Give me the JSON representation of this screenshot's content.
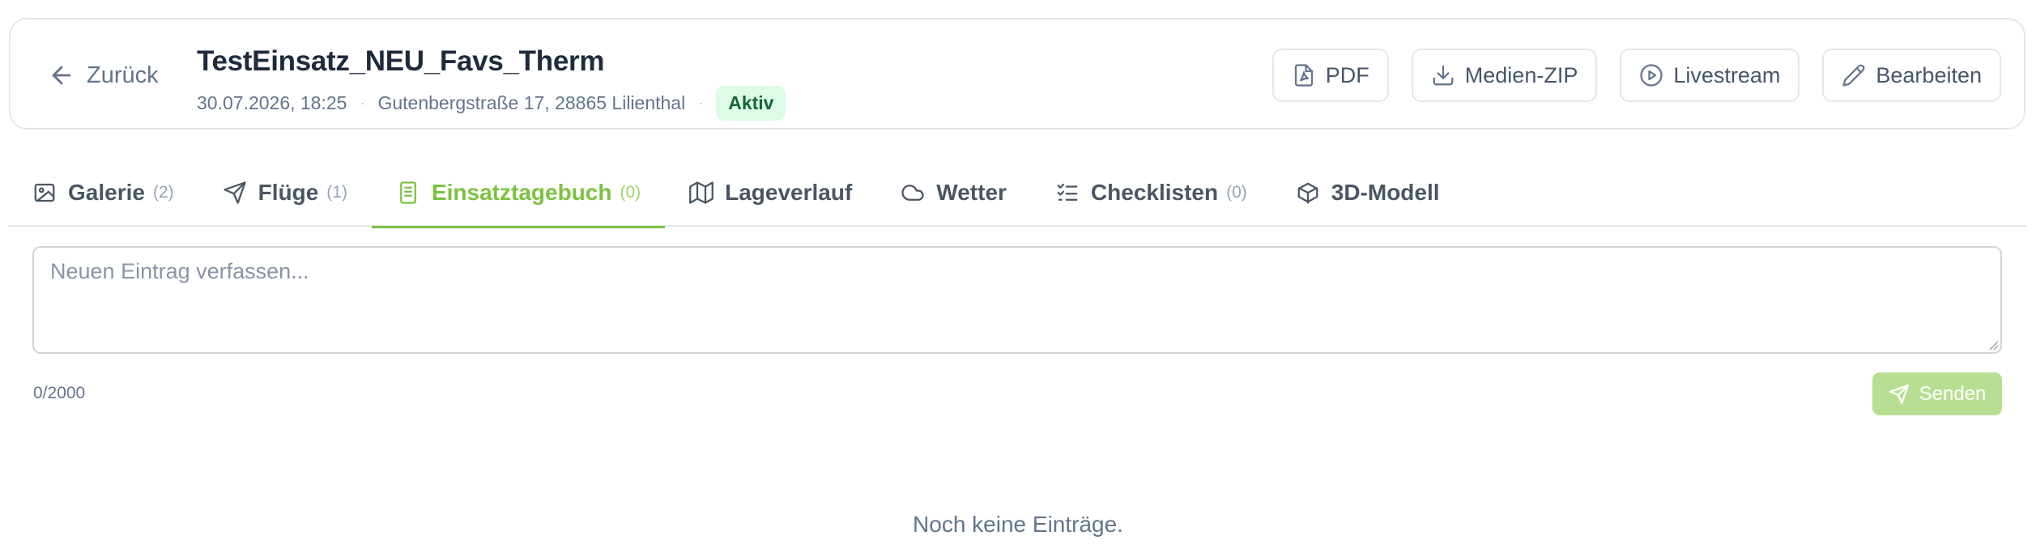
{
  "header": {
    "back_label": "Zurück",
    "title": "TestEinsatz_NEU_Favs_Therm",
    "date": "30.07.2026, 18:25",
    "address": "Gutenbergstraße 17, 28865 Lilienthal",
    "separator": "·",
    "status": "Aktiv",
    "actions": {
      "pdf": "PDF",
      "media_zip": "Medien-ZIP",
      "livestream": "Livestream",
      "edit": "Bearbeiten"
    }
  },
  "tabs": [
    {
      "label": "Galerie",
      "count": "(2)",
      "icon": "gallery-icon"
    },
    {
      "label": "Flüge",
      "count": "(1)",
      "icon": "send-icon"
    },
    {
      "label": "Einsatztagebuch",
      "count": "(0)",
      "icon": "notebook-icon",
      "active": true
    },
    {
      "label": "Lageverlauf",
      "count": "",
      "icon": "map-icon"
    },
    {
      "label": "Wetter",
      "count": "",
      "icon": "cloud-icon"
    },
    {
      "label": "Checklisten",
      "count": "(0)",
      "icon": "checklist-icon"
    },
    {
      "label": "3D-Modell",
      "count": "",
      "icon": "cube-icon"
    }
  ],
  "composer": {
    "placeholder": "Neuen Eintrag verfassen...",
    "value": "",
    "char_count": "0/2000",
    "send_label": "Senden"
  },
  "empty_text": "Noch keine Einträge.",
  "colors": {
    "accent": "#7cc242",
    "send_disabled": "#b7df93",
    "badge_bg": "#dcfce7",
    "badge_text": "#166534",
    "border": "#e5e7eb"
  }
}
